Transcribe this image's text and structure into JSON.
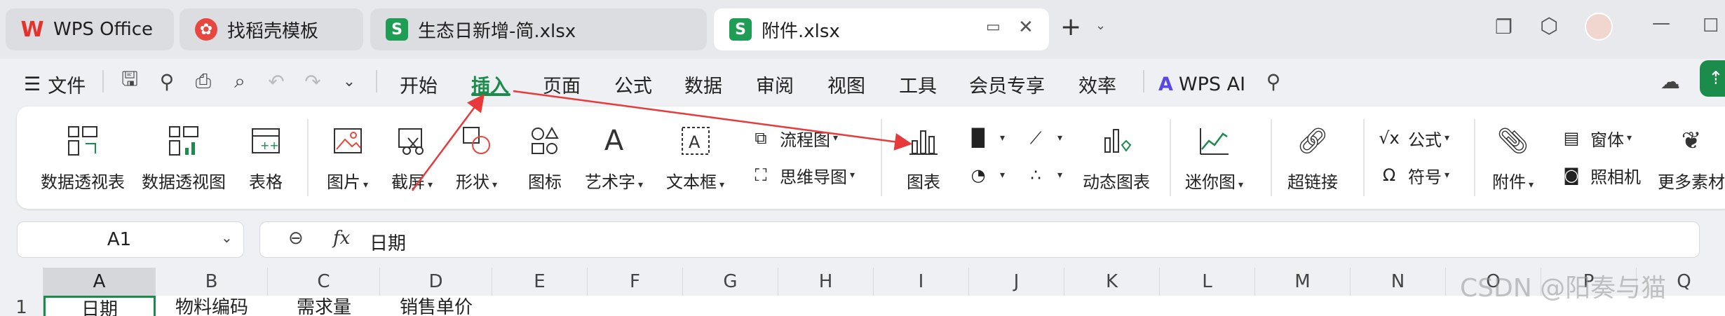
{
  "tabs": [
    {
      "label": "WPS Office",
      "icon": "wps-logo-icon",
      "active": false
    },
    {
      "label": "找稻壳模板",
      "icon": "daoke-icon",
      "active": false
    },
    {
      "label": "生态日新增-简.xlsx",
      "icon": "spreadsheet-icon",
      "active": false
    },
    {
      "label": "附件.xlsx",
      "icon": "spreadsheet-icon",
      "active": true
    }
  ],
  "menu": {
    "file_label": "文件",
    "items": [
      "开始",
      "插入",
      "页面",
      "公式",
      "数据",
      "审阅",
      "视图",
      "工具",
      "会员专享",
      "效率"
    ],
    "selected": "插入",
    "ai_label": "WPS AI"
  },
  "ribbon": {
    "pivot_table": "数据透视表",
    "pivot_chart": "数据透视图",
    "table": "表格",
    "picture": "图片",
    "screenshot": "截屏",
    "shape": "形状",
    "icon": "图标",
    "wordart": "艺术字",
    "textbox": "文本框",
    "flowchart": "流程图",
    "mindmap": "思维导图",
    "chart": "图表",
    "dynamic_chart": "动态图表",
    "sparkline": "迷你图",
    "hyperlink": "超链接",
    "formula": "公式",
    "symbol": "符号",
    "attachment": "附件",
    "object": "窗体",
    "camera": "照相机",
    "more_material": "更多素材"
  },
  "formula_bar": {
    "cell_ref": "A1",
    "fx": "fx",
    "content": "日期"
  },
  "columns": [
    "A",
    "B",
    "C",
    "D",
    "E",
    "F",
    "G",
    "H",
    "I",
    "J",
    "K",
    "L",
    "M",
    "N",
    "O",
    "P",
    "Q"
  ],
  "row": {
    "number": "1",
    "cells": [
      "日期",
      "物料编码",
      "需求量",
      "销售单价"
    ]
  },
  "watermark": "CSDN @阳奏与猫",
  "colors": {
    "accent_green": "#1b8c4c",
    "arrow_red": "#e83a3a"
  }
}
